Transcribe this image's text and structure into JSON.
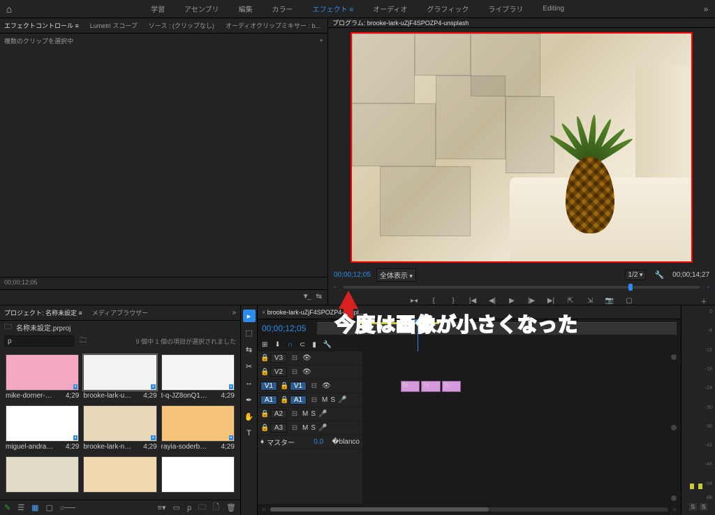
{
  "workspaces": {
    "items": [
      "学習",
      "アセンブリ",
      "編集",
      "カラー",
      "エフェクト",
      "オーディオ",
      "グラフィック",
      "ライブラリ",
      "Editing"
    ],
    "active_index": 4
  },
  "fx_panel": {
    "tabs": [
      "エフェクトコントロール",
      "Lumetri スコープ",
      "ソース : (クリップなし)",
      "オーディオクリップミキサー : b..."
    ],
    "active_index": 0,
    "selection_text": "複数のクリップを選択中",
    "timecode": "00;00;12;05"
  },
  "program": {
    "tab_label": "プログラム: brooke-lark-uZjF4SPOZP4-unsplash",
    "tc_current": "00;00;12;05",
    "tc_duration": "00;00;14;27",
    "fit_label": "全体表示",
    "zoom_label": "1/2",
    "transport_icons": [
      "▸◂",
      "{",
      "}",
      "◂◂",
      "◀|",
      "◀",
      "▶",
      "|▶",
      "▶▶",
      "↪",
      "⎘",
      "✂",
      "📷",
      "□"
    ]
  },
  "annotation": {
    "text": "今度は画像が小さくなった"
  },
  "project": {
    "tabs": [
      "プロジェクト: 名称未設定",
      "メディアブラウザー"
    ],
    "active_index": 0,
    "file_label": "名称未設定.prproj",
    "search_ph": "ρ",
    "sel_info": "9 個中 1 個の項目が選択されました",
    "thumbs": [
      {
        "name": "mike-dorner-sf_1ZDA1Y...",
        "dur": "4;29",
        "bg": "#f5a7c4"
      },
      {
        "name": "brooke-lark-uZjF4SPOZ...",
        "dur": "4;29",
        "bg": "#f2f2f2",
        "selected": true
      },
      {
        "name": "t-q-JZ8onQ1wuY8-unspl...",
        "dur": "4;29",
        "bg": "#f5f5f5"
      },
      {
        "name": "miguel-andrade-nAOZCY...",
        "dur": "4;29",
        "bg": "#ffffff"
      },
      {
        "name": "brooke-lark-nTZOILVZu...",
        "dur": "4;29",
        "bg": "#e8d8b8"
      },
      {
        "name": "rayia-soderberg-ozSFnAF...",
        "dur": "4;29",
        "bg": "#f5c478"
      },
      {
        "name": "",
        "dur": "",
        "bg": "#e0dcc8"
      },
      {
        "name": "",
        "dur": "",
        "bg": "#f2d8b0"
      },
      {
        "name": "",
        "dur": "",
        "bg": "#ffffff"
      }
    ]
  },
  "timeline": {
    "tab": "brooke-lark-uZjF4SPOZP4-unspl...",
    "tc": "00;00;12;05",
    "video_tracks": [
      {
        "name": "V3",
        "src": false
      },
      {
        "name": "V2",
        "src": false
      },
      {
        "name": "V1",
        "src": true
      }
    ],
    "audio_tracks": [
      {
        "name": "A1",
        "mute": "M",
        "solo": "S"
      },
      {
        "name": "A2",
        "mute": "M",
        "solo": "S"
      },
      {
        "name": "A3",
        "mute": "M",
        "solo": "S"
      }
    ],
    "master": {
      "label": "マスター",
      "value": "0.0"
    },
    "clip_label": "fx"
  },
  "meters": {
    "ticks": [
      "0",
      "-6",
      "-12",
      "-18",
      "-24",
      "-30",
      "-36",
      "-42",
      "-48",
      "-54",
      "dB"
    ],
    "solo": "S"
  }
}
